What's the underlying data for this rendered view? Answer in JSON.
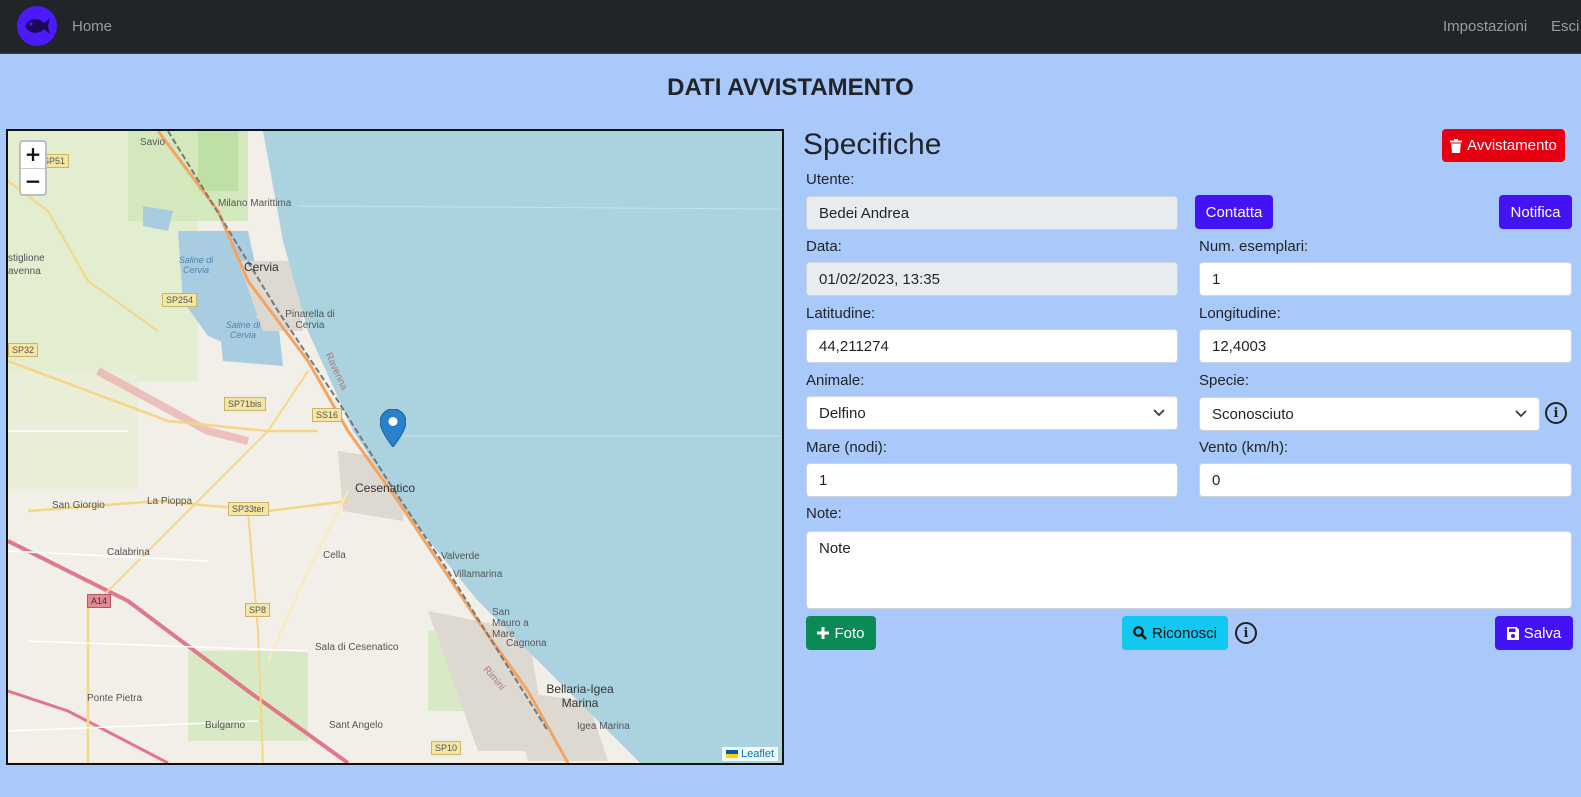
{
  "navbar": {
    "brand_icon": "fish-icon",
    "home": "Home",
    "settings": "Impostazioni",
    "exit": "Esci"
  },
  "page_title": "DATI AVVISTAMENTO",
  "map": {
    "zoom_in": "+",
    "zoom_out": "−",
    "attribution": "Leaflet",
    "labels": {
      "savio": "Savio",
      "milano_marittima": "Milano Marittima",
      "cervia": "Cervia",
      "saline_cervia_1": "Saline di Cervia",
      "saline_cervia_2": "Saline di Cervia",
      "pinarella": "Pinarella di Cervia",
      "castiglione": "stiglione",
      "ravenna": "avenna",
      "cesenatico": "Cesenatico",
      "san_giorgio": "San Giorgio",
      "la_pioppa": "La Pioppa",
      "calabrina": "Calabrina",
      "cella": "Cella",
      "valverde": "Valverde",
      "villamarina": "Villamarina",
      "san_mauro": "San Mauro a Mare",
      "cagnona": "Cagnona",
      "sala": "Sala di Cesenatico",
      "ponte_pietra": "Ponte Pietra",
      "bulgarno": "Bulgarno",
      "sant_angelo": "Sant Angelo",
      "bellaria": "Bellaria-Igea Marina",
      "igea_marina": "Igea Marina",
      "rimini": "Rimini",
      "ravenna_road": "Ravenna"
    },
    "roads": {
      "sp51": "SP51",
      "sp254": "SP254",
      "sp32": "SP32",
      "sp71bis": "SP71bis",
      "ss16": "SS16",
      "sp33ter": "SP33ter",
      "a14": "A14",
      "sp8": "SP8",
      "sp10": "SP10"
    }
  },
  "form": {
    "section_title": "Specifiche",
    "delete_button": "Avvistamento",
    "contact_button": "Contatta",
    "notify_button": "Notifica",
    "user_label": "Utente:",
    "user_value": "Bedei Andrea",
    "date_label": "Data:",
    "date_value": "01/02/2023, 13:35",
    "count_label": "Num. esemplari:",
    "count_value": "1",
    "lat_label": "Latitudine:",
    "lat_value": "44,211274",
    "lon_label": "Longitudine:",
    "lon_value": "12,4003",
    "animal_label": "Animale:",
    "animal_value": "Delfino",
    "species_label": "Specie:",
    "species_value": "Sconosciuto",
    "sea_label": "Mare (nodi):",
    "sea_value": "1",
    "wind_label": "Vento (km/h):",
    "wind_value": "0",
    "notes_label": "Note:",
    "notes_value": "Note",
    "photo_button": "Foto",
    "recognize_button": "Riconosci",
    "save_button": "Salva"
  }
}
